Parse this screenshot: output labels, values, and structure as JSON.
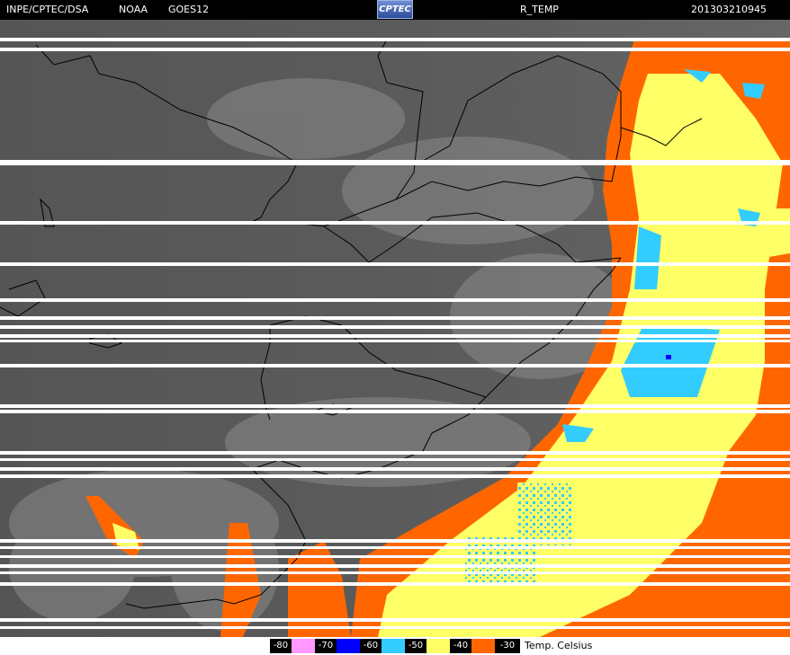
{
  "header": {
    "source": "INPE/CPTEC/DSA",
    "agency": "NOAA",
    "satellite": "GOES12",
    "logo_text": "CPTEC",
    "product": "R_TEMP",
    "timestamp": "201303210945"
  },
  "legend": {
    "entries": [
      {
        "label": "-80",
        "color": "#ff99ff"
      },
      {
        "label": "-70",
        "color": "#0000ff"
      },
      {
        "label": "-60",
        "color": "#33ccff"
      },
      {
        "label": "-50",
        "color": "#ffff66"
      },
      {
        "label": "-40",
        "color": "#ff6600"
      },
      {
        "label": "-30",
        "color": null
      }
    ],
    "unit": "Temp. Celsius"
  },
  "colors": {
    "background_gray": "#5a5a5a",
    "scanline": "#ffffff",
    "borders": "#000000"
  }
}
